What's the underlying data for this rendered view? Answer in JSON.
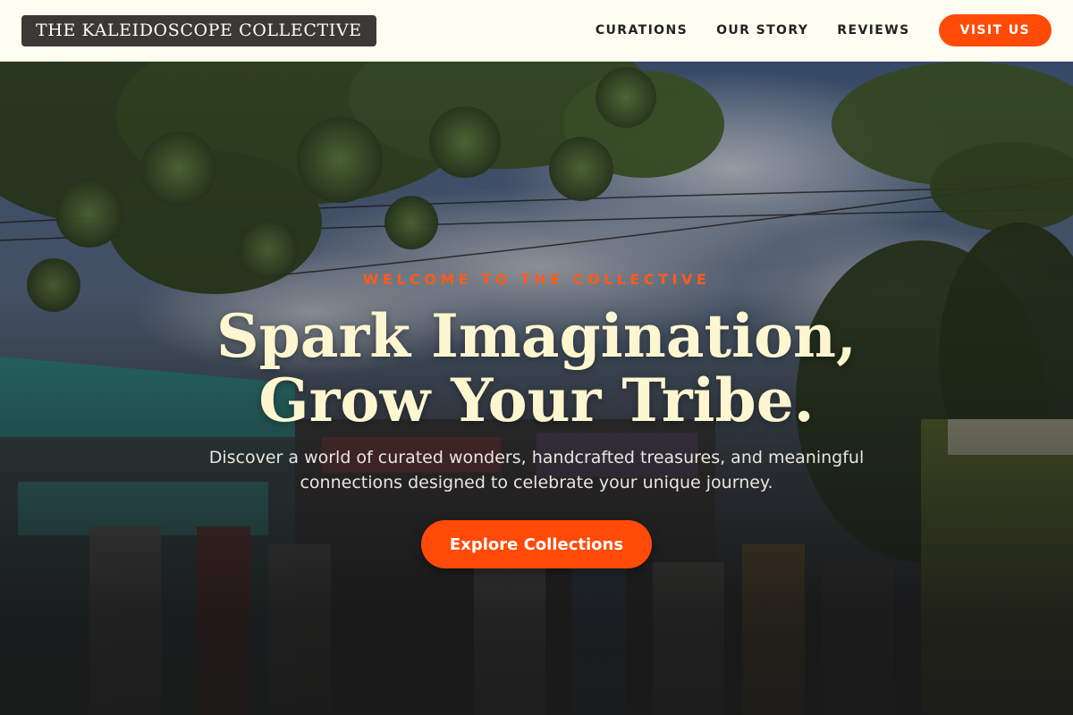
{
  "header": {
    "brand": "THE KALEIDOSCOPE COLLECTIVE",
    "nav": [
      {
        "label": "CURATIONS"
      },
      {
        "label": "OUR STORY"
      },
      {
        "label": "REVIEWS"
      }
    ],
    "visit_label": "VISIT US"
  },
  "hero": {
    "eyebrow": "WELCOME TO THE COLLECTIVE",
    "headline_line1": "Spark Imagination,",
    "headline_line2": "Grow Your Tribe.",
    "subtext": "Discover a world of curated wonders, handcrafted treasures, and meaningful connections designed to celebrate your unique journey.",
    "cta_label": "Explore Collections",
    "background_image": "photo-of-gift-shop-street-with-tree-and-cloudy-sky"
  },
  "colors": {
    "accent": "#ff4a08",
    "header_bg": "#fffdf2",
    "brand_bg": "#3a3937",
    "headline": "#fdf6d0"
  }
}
